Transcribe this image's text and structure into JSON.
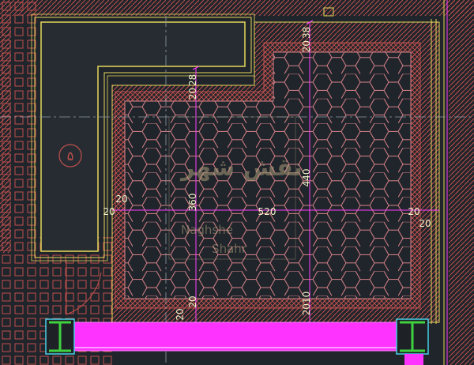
{
  "room_number": "۵",
  "dimensions": {
    "top_upper": "20",
    "top_upper_b": "38",
    "left_top_a": "20",
    "left_top_b": "28",
    "width_520": "520",
    "height_360": "360",
    "height_440": "440",
    "left_20_a": "20",
    "left_20_b": "20",
    "right_20_a": "20",
    "right_20_b": "20",
    "bottom_20_a": "20",
    "bottom_20_b": "20",
    "bottom_2010": "2010"
  },
  "watermark": {
    "logo_text": "نقش شهر",
    "line1": "Naghshe",
    "line2": "Shahr"
  },
  "colors": {
    "background": "#20252b",
    "hatch_red": "#c0504d",
    "hex_pink": "#d9838a",
    "wall_yellow": "#e6d85a",
    "dim_magenta": "#ff40ff",
    "accent_green": "#3fd13f",
    "cyan": "#46d0e6",
    "axis_gray": "#8f9aa6"
  }
}
